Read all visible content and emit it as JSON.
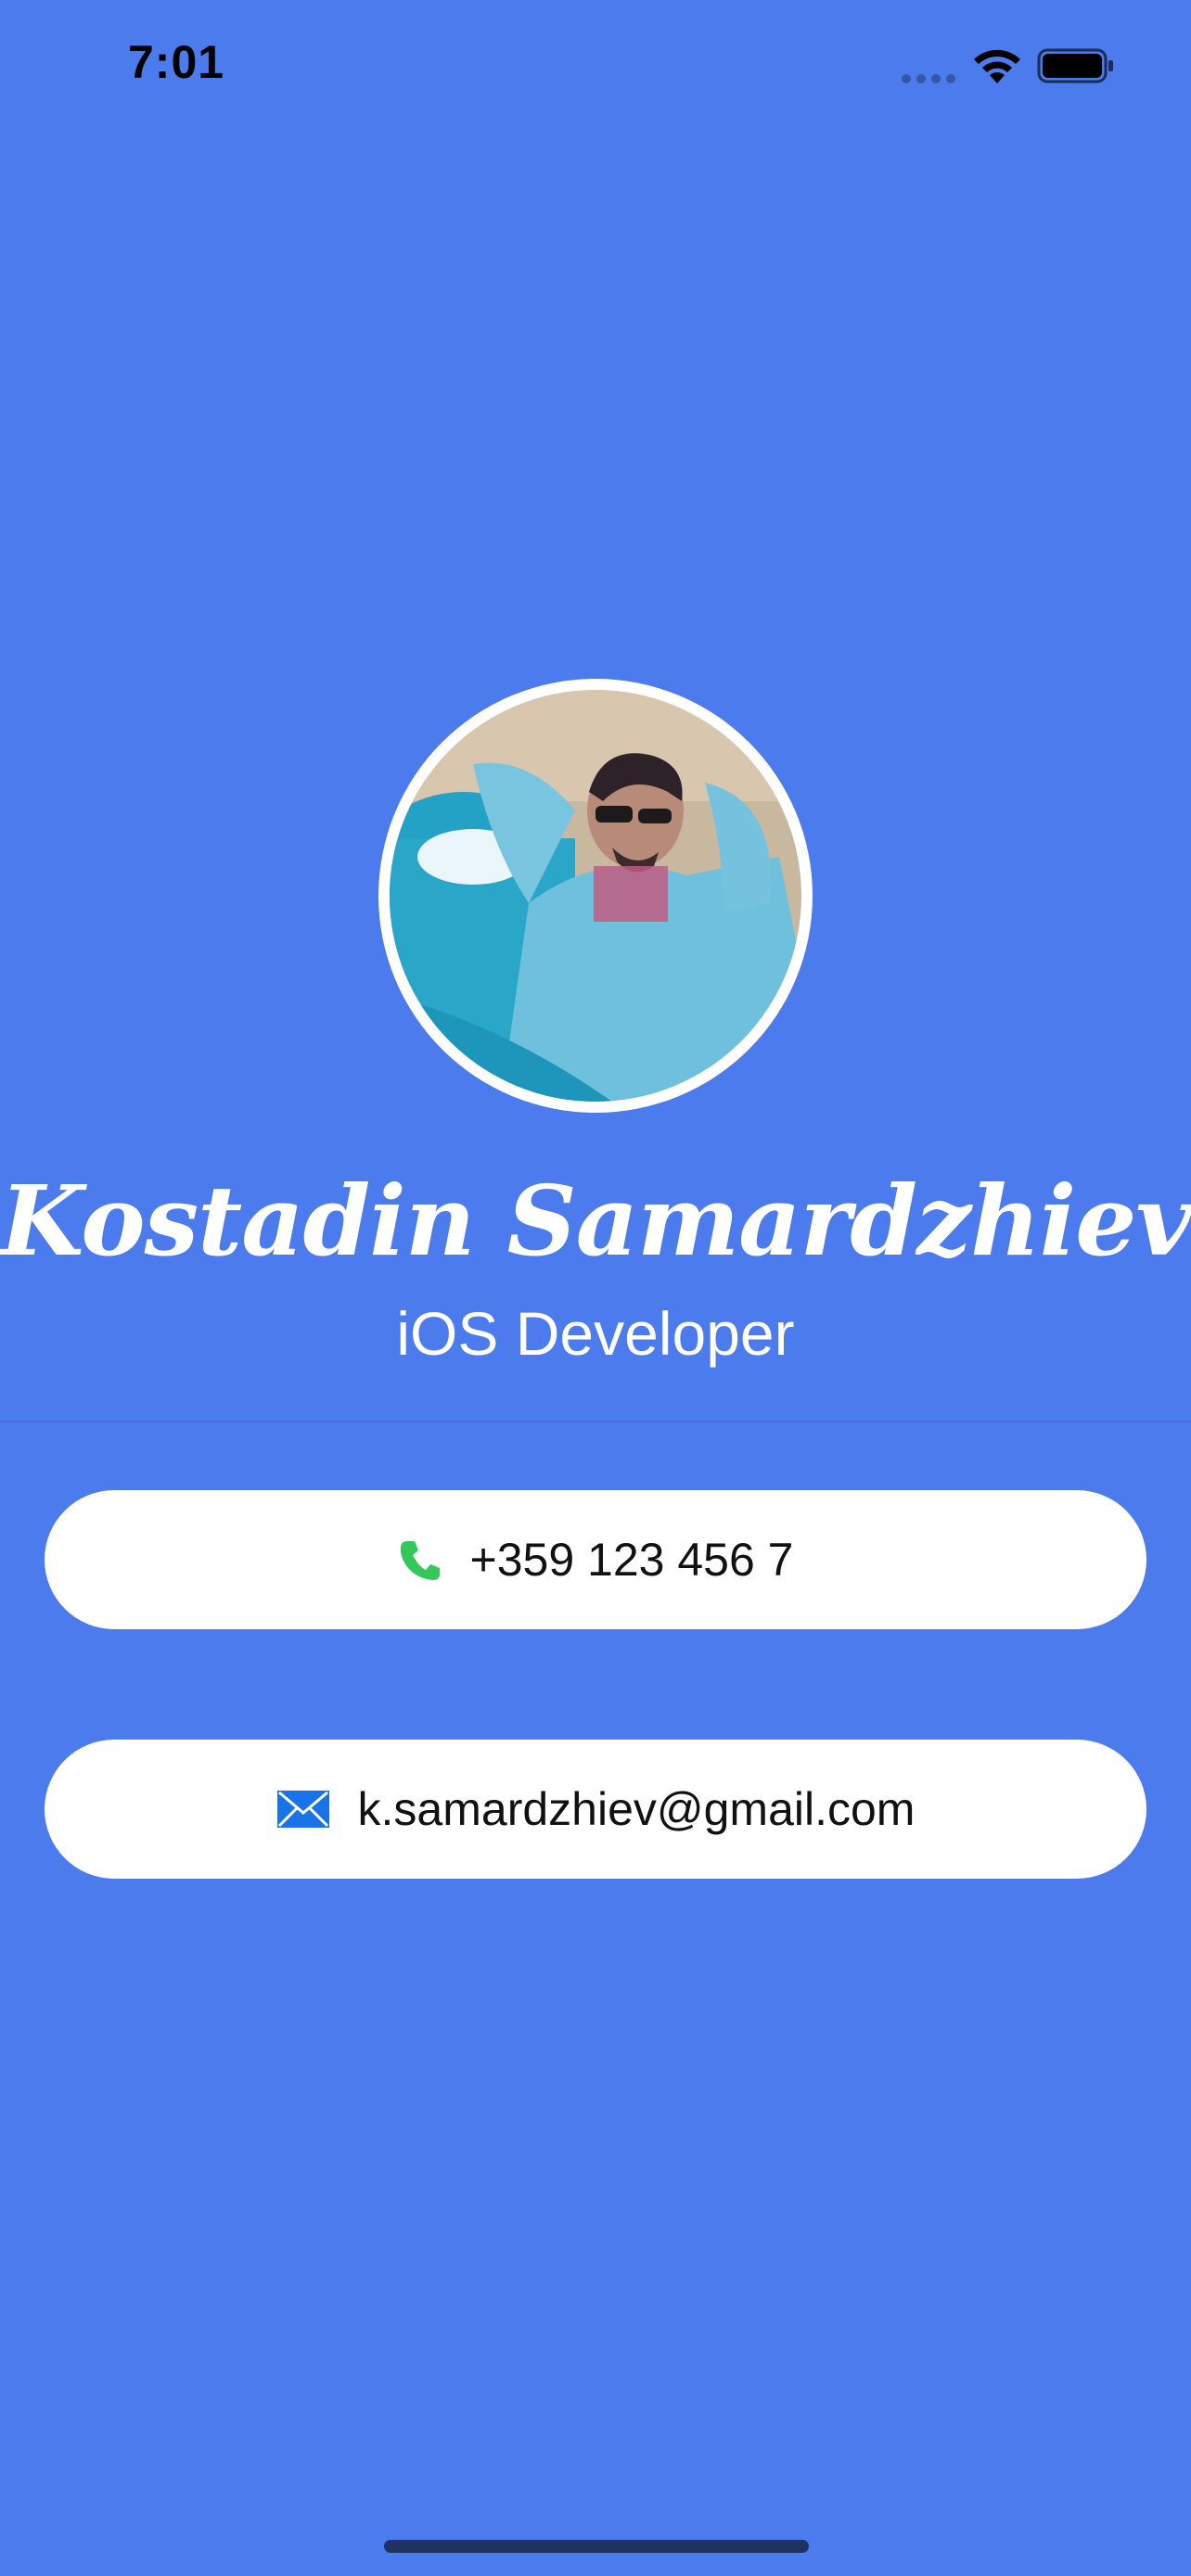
{
  "status_bar": {
    "time": "7:01",
    "icons": [
      "cellular-signal-icon",
      "wifi-icon",
      "battery-icon"
    ]
  },
  "profile": {
    "photo": "profile-photo",
    "name": "Kostadin Samardzhiev",
    "title": "iOS Developer"
  },
  "contacts": {
    "phone": {
      "icon": "phone-icon",
      "label": "+359 123 456 7"
    },
    "email": {
      "icon": "envelope-icon",
      "label": "k.samardzhiev@gmail.com"
    }
  },
  "colors": {
    "background": "#4c7bed",
    "card": "#ffffff",
    "phone_icon": "#34c759",
    "email_icon": "#1a73e8"
  }
}
